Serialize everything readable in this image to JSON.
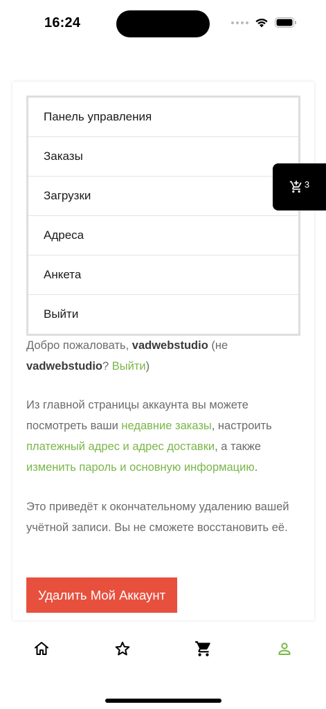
{
  "status_bar": {
    "time": "16:24"
  },
  "floating_cart": {
    "count": "3"
  },
  "account_menu": {
    "items": [
      {
        "label": "Панель управления"
      },
      {
        "label": "Заказы"
      },
      {
        "label": "Загрузки"
      },
      {
        "label": "Адреса"
      },
      {
        "label": "Анкета"
      },
      {
        "label": "Выйти"
      }
    ]
  },
  "welcome": {
    "prefix": "Добро пожаловать, ",
    "username": "vadwebstudio",
    "middle": " (не ",
    "username2": "vadwebstudio",
    "question": "? ",
    "logout_link": "Выйти",
    "suffix": ")"
  },
  "intro": {
    "part1": "Из главной страницы аккаунта вы можете посмотреть ваши ",
    "link_orders": "недавние заказы",
    "part2": ", настроить ",
    "link_addresses": "платежный адрес и адрес доставки",
    "part3": ", а также ",
    "link_account": "изменить пароль и основную информацию",
    "part4": "."
  },
  "delete_notice": "Это приведёт к окончательному удалению вашей учётной записи. Вы не сможете восстановить её.",
  "delete_button": "Удалить Мой Аккаунт",
  "bottom_nav": {
    "items": [
      "home-icon",
      "star-icon",
      "cart-icon",
      "account-icon"
    ],
    "active_color": "#7ab648"
  },
  "colors": {
    "accent": "#7ab648",
    "danger": "#e8503e"
  }
}
